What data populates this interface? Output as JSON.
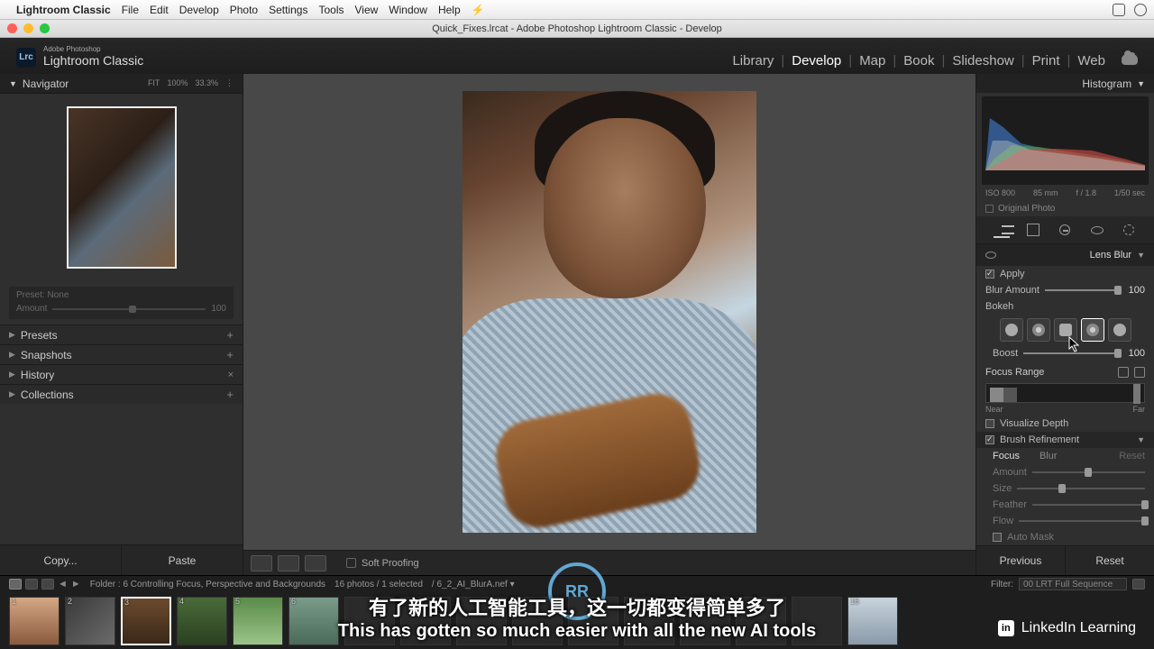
{
  "os": {
    "app_name": "Lightroom Classic",
    "menus": [
      "File",
      "Edit",
      "Develop",
      "Photo",
      "Settings",
      "Tools",
      "View",
      "Window",
      "Help"
    ],
    "window_title": "Quick_Fixes.lrcat - Adobe Photoshop Lightroom Classic - Develop"
  },
  "brand": {
    "badge": "Lrc",
    "line1": "Adobe Photoshop",
    "line2": "Lightroom Classic"
  },
  "modules": {
    "items": [
      "Library",
      "Develop",
      "Map",
      "Book",
      "Slideshow",
      "Print",
      "Web"
    ],
    "active": "Develop"
  },
  "navigator": {
    "title": "Navigator",
    "mode": "FIT",
    "zoom": "100%",
    "pct": "33.3%"
  },
  "preset_box": {
    "label": "Preset:",
    "value": "None",
    "amount_label": "Amount",
    "amount_value": "100"
  },
  "left_sections": {
    "presets": "Presets",
    "snapshots": "Snapshots",
    "history": "History",
    "collections": "Collections"
  },
  "left_foot": {
    "copy": "Copy...",
    "paste": "Paste"
  },
  "center_toolbar": {
    "soft_proofing": "Soft Proofing"
  },
  "histogram": {
    "title": "Histogram",
    "iso": "ISO 800",
    "focal": "85 mm",
    "aperture": "f / 1.8",
    "shutter": "1/50 sec",
    "original_photo": "Original Photo"
  },
  "lens_blur": {
    "title": "Lens Blur",
    "apply": "Apply",
    "blur_amount": {
      "label": "Blur Amount",
      "value": "100"
    },
    "bokeh": "Bokeh",
    "boost": {
      "label": "Boost",
      "value": "100"
    },
    "focus_range": {
      "label": "Focus Range",
      "near": "Near",
      "far": "Far"
    },
    "visualize_depth": "Visualize Depth",
    "brush_refinement": "Brush Refinement",
    "brush_tabs": {
      "focus": "Focus",
      "blur": "Blur",
      "reset": "Reset"
    },
    "brush_sliders": {
      "amount": "Amount",
      "size": "Size",
      "feather": "Feather",
      "flow": "Flow"
    },
    "auto_mask": "Auto Mask"
  },
  "right_foot": {
    "previous": "Previous",
    "reset": "Reset"
  },
  "filmstrip": {
    "folder": "Folder : 6 Controlling Focus, Perspective and Backgrounds",
    "count": "16 photos / 1 selected",
    "file": "/ 6_2_AI_BlurA.nef ▾",
    "filter_label": "Filter:",
    "filter_value": "00 LRT Full Sequence",
    "thumbs": [
      "1",
      "2",
      "3",
      "4",
      "5",
      "6",
      "",
      "",
      "",
      "",
      "",
      "",
      "",
      "",
      "",
      "16"
    ]
  },
  "subtitles": {
    "cn": "有了新的人工智能工具，这一切都变得简单多了",
    "en": "This has gotten so much easier with all the new AI tools"
  },
  "watermark": {
    "brand": "LinkedIn Learning"
  }
}
